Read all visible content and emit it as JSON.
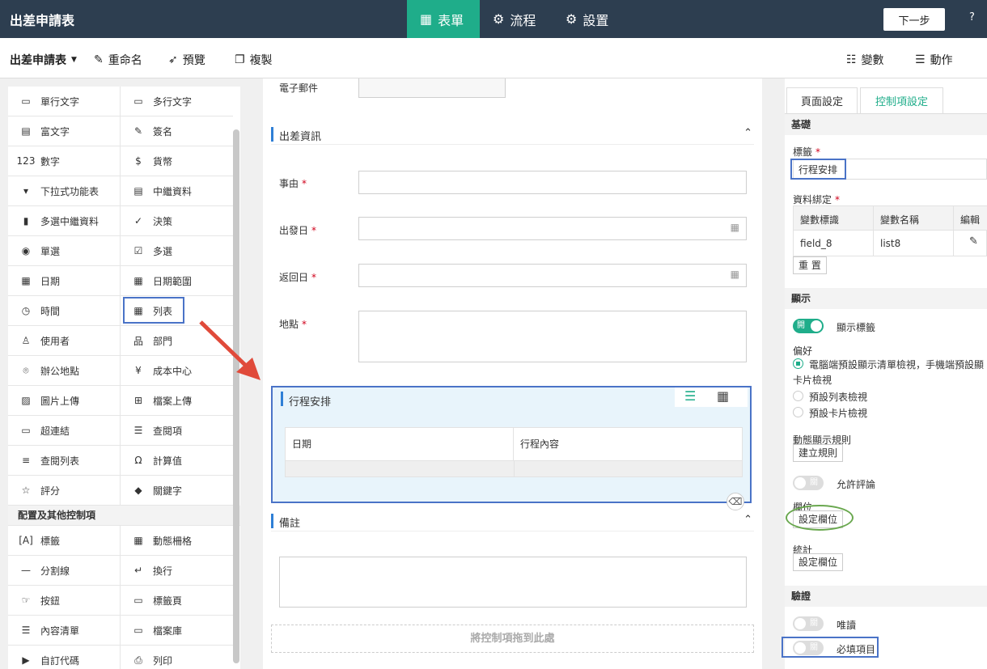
{
  "app": {
    "title": "出差申請表"
  },
  "nav": {
    "form": "表單",
    "flow": "流程",
    "settings": "設置"
  },
  "header": {
    "next": "下一步",
    "help": "?"
  },
  "toolbar": {
    "form_name": "出差申請表",
    "rename": "重命名",
    "preview": "預覽",
    "copy": "複製",
    "variables": "變數",
    "actions": "動作"
  },
  "palette": {
    "basic": [
      {
        "label": "單行文字",
        "icon": "single-line-icon",
        "glyph": "▭"
      },
      {
        "label": "多行文字",
        "icon": "multi-line-icon",
        "glyph": "▭"
      },
      {
        "label": "富文字",
        "icon": "rich-text-icon",
        "glyph": "▤"
      },
      {
        "label": "簽名",
        "icon": "signature-icon",
        "glyph": "✎"
      },
      {
        "label": "數字",
        "icon": "number-icon",
        "glyph": "123"
      },
      {
        "label": "貨幣",
        "icon": "currency-icon",
        "glyph": "$"
      },
      {
        "label": "下拉式功能表",
        "icon": "dropdown-icon",
        "glyph": "▾"
      },
      {
        "label": "中繼資料",
        "icon": "metadata-icon",
        "glyph": "▤"
      },
      {
        "label": "多選中繼資料",
        "icon": "multi-metadata-icon",
        "glyph": "▮"
      },
      {
        "label": "決策",
        "icon": "decision-icon",
        "glyph": "✓"
      },
      {
        "label": "單選",
        "icon": "radio-icon",
        "glyph": "◉"
      },
      {
        "label": "多選",
        "icon": "checkbox-icon",
        "glyph": "☑"
      },
      {
        "label": "日期",
        "icon": "calendar-icon",
        "glyph": "▦"
      },
      {
        "label": "日期範圍",
        "icon": "date-range-icon",
        "glyph": "▦"
      },
      {
        "label": "時間",
        "icon": "clock-icon",
        "glyph": "◷"
      },
      {
        "label": "列表",
        "icon": "table-icon",
        "glyph": "▦"
      },
      {
        "label": "使用者",
        "icon": "user-icon",
        "glyph": "♙"
      },
      {
        "label": "部門",
        "icon": "org-chart-icon",
        "glyph": "品"
      },
      {
        "label": "辦公地點",
        "icon": "location-pin-icon",
        "glyph": "⌾"
      },
      {
        "label": "成本中心",
        "icon": "yen-icon",
        "glyph": "¥"
      },
      {
        "label": "圖片上傳",
        "icon": "image-icon",
        "glyph": "▨"
      },
      {
        "label": "檔案上傳",
        "icon": "file-upload-icon",
        "glyph": "⊞"
      },
      {
        "label": "超連結",
        "icon": "link-icon",
        "glyph": "▭"
      },
      {
        "label": "查閱項",
        "icon": "lookup-icon",
        "glyph": "☰"
      },
      {
        "label": "查閱列表",
        "icon": "lookup-list-icon",
        "glyph": "≡"
      },
      {
        "label": "計算值",
        "icon": "omega-icon",
        "glyph": "Ω"
      },
      {
        "label": "評分",
        "icon": "star-icon",
        "glyph": "☆"
      },
      {
        "label": "關鍵字",
        "icon": "tag-icon",
        "glyph": "◆"
      }
    ],
    "layout_header": "配置及其他控制項",
    "layout": [
      {
        "label": "標籤",
        "icon": "label-icon",
        "glyph": "[A]"
      },
      {
        "label": "動態柵格",
        "icon": "grid-icon",
        "glyph": "▦"
      },
      {
        "label": "分割線",
        "icon": "divider-icon",
        "glyph": "—"
      },
      {
        "label": "換行",
        "icon": "line-break-icon",
        "glyph": "↵"
      },
      {
        "label": "按鈕",
        "icon": "button-icon",
        "glyph": "☞"
      },
      {
        "label": "標籤頁",
        "icon": "tab-page-icon",
        "glyph": "▭"
      },
      {
        "label": "內容清單",
        "icon": "list-icon",
        "glyph": "☰"
      },
      {
        "label": "檔案庫",
        "icon": "folder-icon",
        "glyph": "▭"
      },
      {
        "label": "自訂代碼",
        "icon": "code-icon",
        "glyph": "▶"
      },
      {
        "label": "列印",
        "icon": "print-icon",
        "glyph": "⎙"
      }
    ]
  },
  "form": {
    "email_label": "電子郵件",
    "trip_section": "出差資訊",
    "reason_label": "事由",
    "depart_label": "出發日",
    "return_label": "返回日",
    "place_label": "地點",
    "table_title": "行程安排",
    "table_cols": [
      "日期",
      "行程內容"
    ],
    "notes_section": "備註",
    "drop_hint": "將控制項拖到此處"
  },
  "props": {
    "tab_page": "頁面設定",
    "tab_control": "控制項設定",
    "basic": "基礎",
    "label_label": "標籤",
    "label_value": "行程安排",
    "binding_label": "資料綁定",
    "binding_cols": [
      "變數標識",
      "變數名稱",
      "編輯"
    ],
    "binding_row": [
      "field_8",
      "list8"
    ],
    "reset": "重 置",
    "display": "顯示",
    "on": "開",
    "off": "關",
    "show_label": "顯示標籤",
    "pref": "偏好",
    "pref_value": "電腦端預設顯示清單檢視，手機端預設顯",
    "card_view": "卡片檢視",
    "default_list": "預設列表檢視",
    "default_card": "預設卡片檢視",
    "dyn_rule": "動態顯示規則",
    "create_rule": "建立規則",
    "allow_comment": "允許評論",
    "columns": "欄位",
    "set_columns": "設定欄位",
    "stats": "統計",
    "validation": "驗證",
    "readonly": "唯讀",
    "required": "必填項目"
  },
  "colors": {
    "topbar": "#2d3e50",
    "accent": "#1fad8a",
    "highlight": "#4a73c7",
    "arrow": "#e04a3a",
    "circle": "#6aa84f"
  }
}
